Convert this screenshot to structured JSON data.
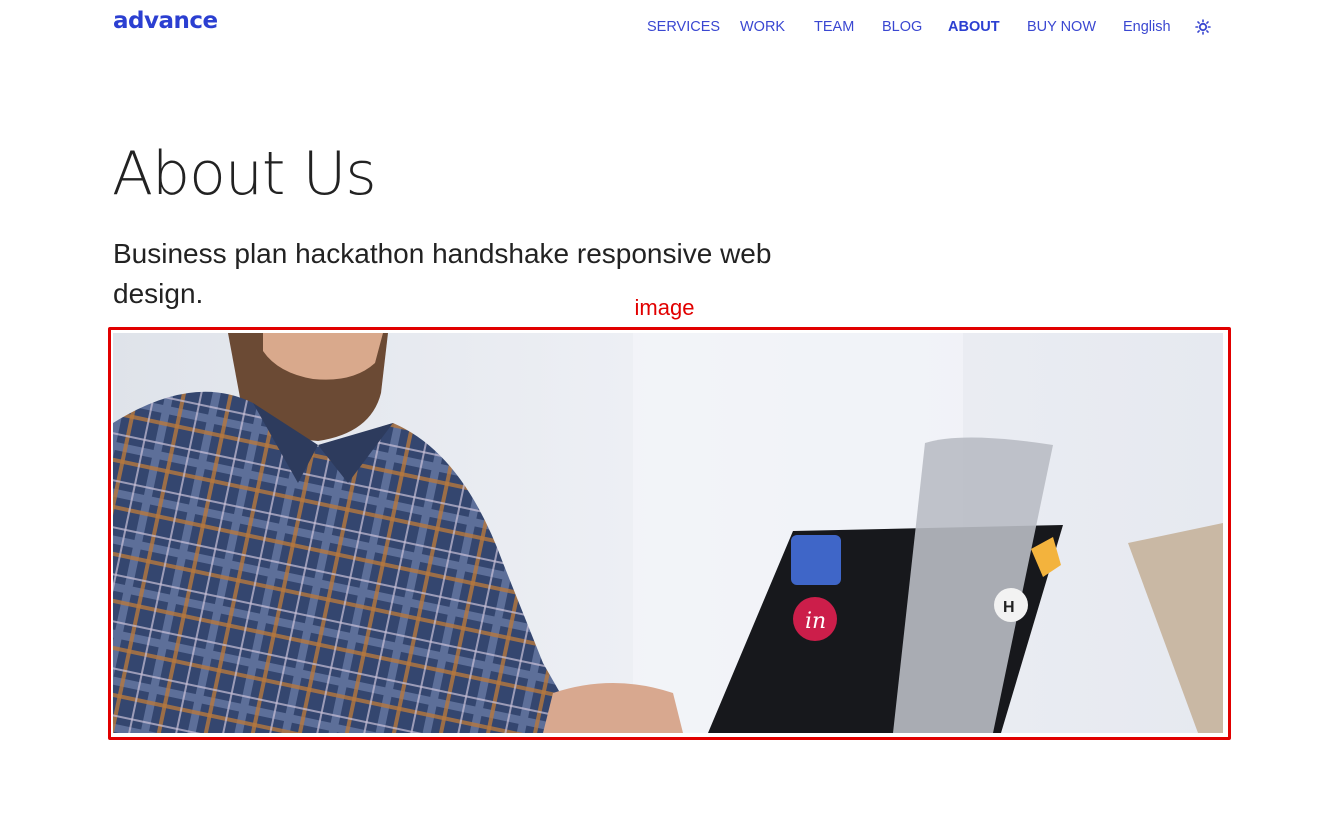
{
  "header": {
    "logo": "advance",
    "nav": [
      {
        "label": "SERVICES",
        "active": false
      },
      {
        "label": "WORK",
        "active": false
      },
      {
        "label": "TEAM",
        "active": false
      },
      {
        "label": "BLOG",
        "active": false
      },
      {
        "label": "ABOUT",
        "active": true
      },
      {
        "label": "BUY NOW",
        "active": false
      },
      {
        "label": "English",
        "active": false
      }
    ],
    "theme_toggle_icon": "sun-icon"
  },
  "main": {
    "title": "About Us",
    "subtitle": "Business plan hackathon handshake responsive web design.",
    "annotation_label": "image",
    "hero_stickers": [
      "in",
      "H"
    ]
  },
  "colors": {
    "brand": "#2b3fd1",
    "nav_link": "#3a47d1",
    "annotation": "#e10000",
    "heading": "#222222"
  }
}
